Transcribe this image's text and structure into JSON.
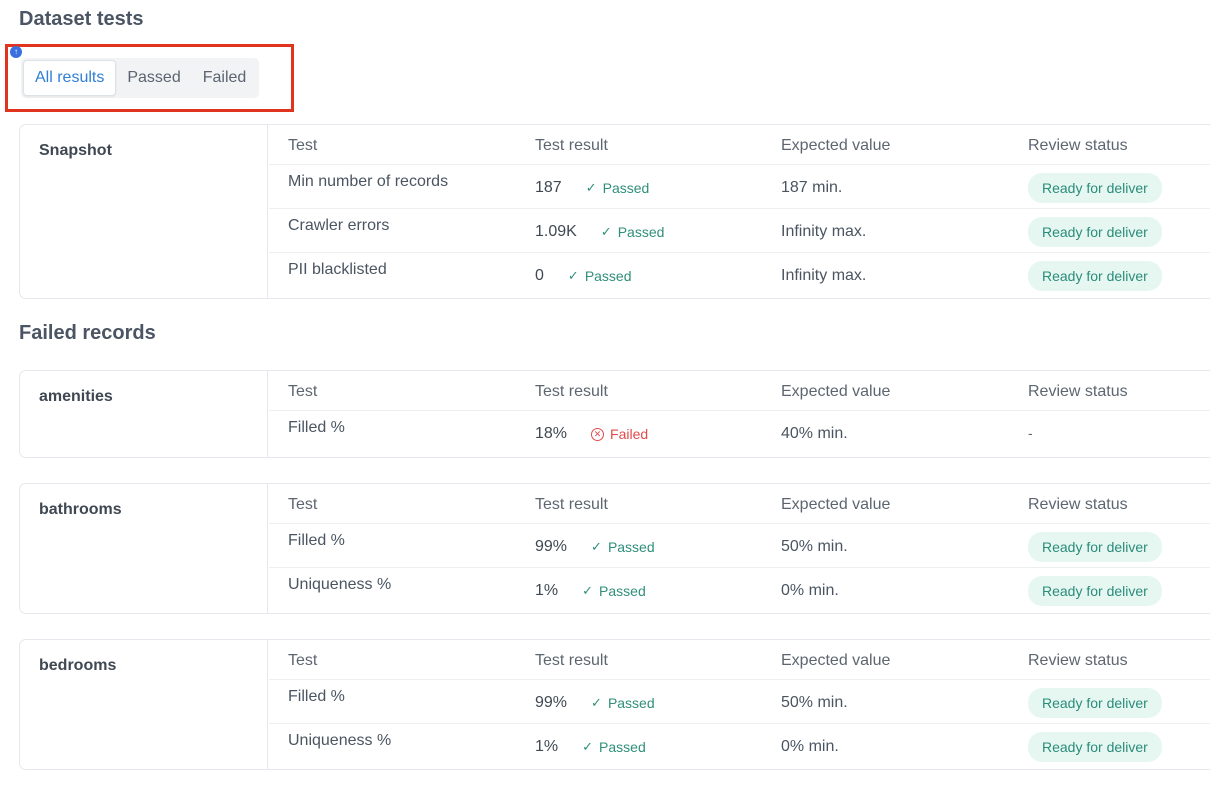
{
  "dataset_title": "Dataset tests",
  "failed_title": "Failed records",
  "marker": "↑",
  "filters": [
    "All results",
    "Passed",
    "Failed"
  ],
  "columns": {
    "test": "Test",
    "result": "Test result",
    "expected": "Expected value",
    "review": "Review status"
  },
  "snapshot": {
    "label": "Snapshot",
    "rows": [
      {
        "test": "Min number of records",
        "value": "187",
        "status": "Passed",
        "expected": "187 min.",
        "review": "Ready for deliver"
      },
      {
        "test": "Crawler errors",
        "value": "1.09K",
        "status": "Passed",
        "expected": "Infinity max.",
        "review": "Ready for deliver"
      },
      {
        "test": "PII blacklisted",
        "value": "0",
        "status": "Passed",
        "expected": "Infinity max.",
        "review": "Ready for deliver"
      }
    ]
  },
  "amenities": {
    "label": "amenities",
    "rows": [
      {
        "test": "Filled %",
        "value": "18%",
        "status": "Failed",
        "expected": "40% min.",
        "review": "-"
      }
    ]
  },
  "bathrooms": {
    "label": "bathrooms",
    "rows": [
      {
        "test": "Filled %",
        "value": "99%",
        "status": "Passed",
        "expected": "50% min.",
        "review": "Ready for deliver"
      },
      {
        "test": "Uniqueness %",
        "value": "1%",
        "status": "Passed",
        "expected": "0% min.",
        "review": "Ready for deliver"
      }
    ]
  },
  "bedrooms": {
    "label": "bedrooms",
    "rows": [
      {
        "test": "Filled %",
        "value": "99%",
        "status": "Passed",
        "expected": "50% min.",
        "review": "Ready for deliver"
      },
      {
        "test": "Uniqueness %",
        "value": "1%",
        "status": "Passed",
        "expected": "0% min.",
        "review": "Ready for deliver"
      }
    ]
  },
  "colors": {
    "accent": "#2f7fd6",
    "passed": "#2f8f7a",
    "failed": "#e14b4b",
    "badge_bg": "#e6f7f2",
    "highlight": "#e1341e"
  },
  "icons": {
    "passed": "check-icon",
    "failed": "x-circle-icon"
  }
}
